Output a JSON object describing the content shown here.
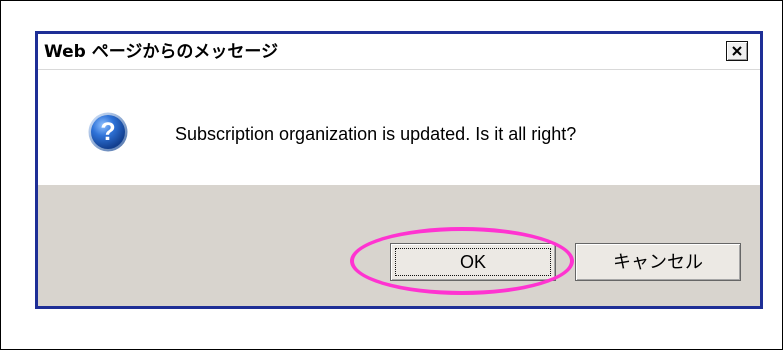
{
  "dialog": {
    "title": "Web ページからのメッセージ",
    "message": "Subscription organization is updated. Is it all right?",
    "ok_label": "OK",
    "cancel_label": "キャンセル"
  },
  "icons": {
    "close": "close-icon",
    "question": "question-icon"
  },
  "colors": {
    "dialog_border": "#1e2e96",
    "button_panel": "#d8d4ce",
    "highlight": "#ff33d1",
    "question_blue": "#1f5fbe"
  }
}
